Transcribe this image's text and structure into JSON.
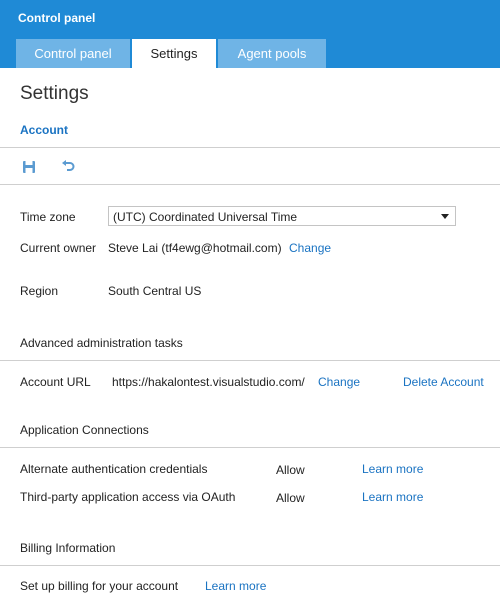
{
  "header": {
    "app_title": "Control panel",
    "tabs": [
      {
        "label": "Control panel",
        "active": false
      },
      {
        "label": "Settings",
        "active": true
      },
      {
        "label": "Agent pools",
        "active": false
      }
    ],
    "accent_color": "#1f8ad6"
  },
  "page": {
    "title": "Settings",
    "section_tab": "Account"
  },
  "toolbar": {
    "save_icon": "save-icon",
    "undo_icon": "undo-icon"
  },
  "account": {
    "time_zone": {
      "label": "Time zone",
      "value": "(UTC) Coordinated Universal Time"
    },
    "current_owner": {
      "label": "Current owner",
      "value": "Steve Lai (tf4ewg@hotmail.com)",
      "link": "Change"
    },
    "region": {
      "label": "Region",
      "value": "South Central US"
    }
  },
  "advanced": {
    "heading": "Advanced administration tasks",
    "account_url": {
      "label": "Account URL",
      "value": "https://hakalontest.visualstudio.com/",
      "change_link": "Change",
      "delete_link": "Delete Account"
    }
  },
  "connections": {
    "heading": "Application Connections",
    "rows": [
      {
        "label": "Alternate authentication credentials",
        "value": "Allow",
        "link": "Learn more"
      },
      {
        "label": "Third-party application access via OAuth",
        "value": "Allow",
        "link": "Learn more"
      }
    ]
  },
  "billing": {
    "heading": "Billing Information",
    "label": "Set up billing for your account",
    "link": "Learn more"
  }
}
